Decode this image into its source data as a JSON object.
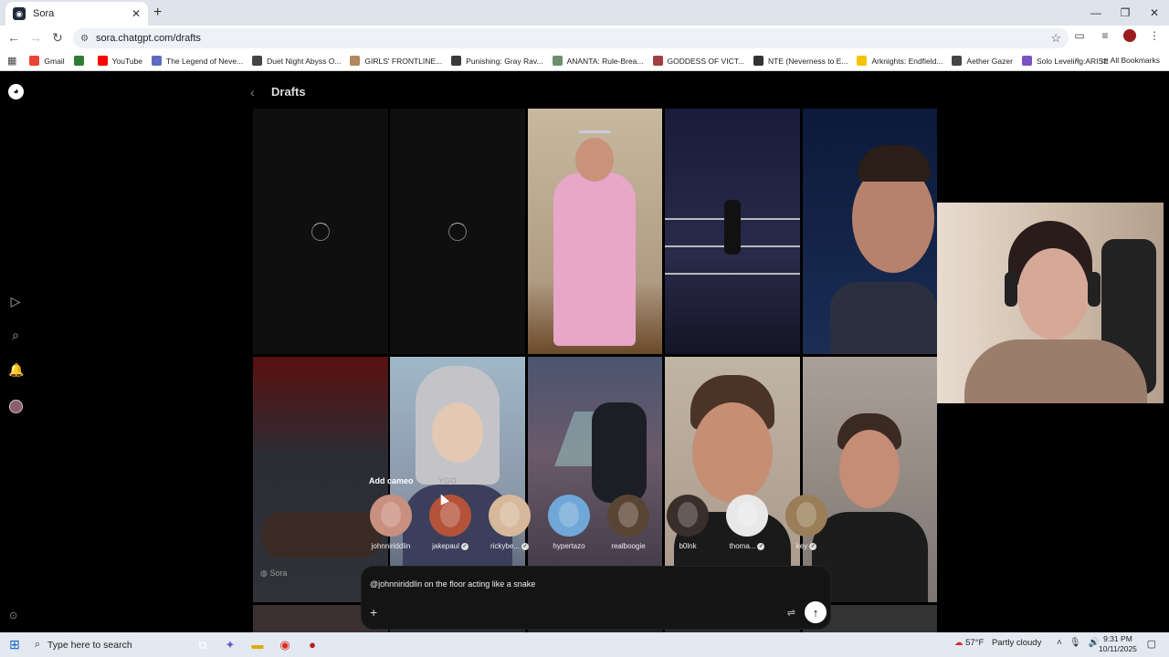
{
  "browser": {
    "tab_title": "Sora",
    "tab_favicon": "sora-favicon",
    "url": "sora.chatgpt.com/drafts",
    "bookmarks": [
      {
        "label": "Gmail",
        "color": "#ea4335"
      },
      {
        "label": "",
        "color": "#2e7d32"
      },
      {
        "label": "YouTube",
        "color": "#ff0000"
      },
      {
        "label": "The Legend of Neve...",
        "color": "#5c6bc0"
      },
      {
        "label": "Duet Night Abyss O...",
        "color": "#444444"
      },
      {
        "label": "GIRLS' FRONTLINE...",
        "color": "#b0875a"
      },
      {
        "label": "Punishing: Gray Rav...",
        "color": "#3a3a3a"
      },
      {
        "label": "ANANTA: Rule-Brea...",
        "color": "#6d8f6d"
      },
      {
        "label": "GODDESS OF VICT...",
        "color": "#a04040"
      },
      {
        "label": "NTE (Neverness to E...",
        "color": "#333333"
      },
      {
        "label": "Arknights: Endfield...",
        "color": "#f5c400"
      },
      {
        "label": "Aether Gazer",
        "color": "#444444"
      },
      {
        "label": "Solo Leveling:ARISE",
        "color": "#7b52c4"
      }
    ],
    "all_bookmarks": "All Bookmarks"
  },
  "page": {
    "title": "Drafts"
  },
  "cameo": {
    "heading": "Add cameo",
    "heading2": "YGO",
    "people": [
      {
        "name": "johnniriddlin",
        "verified": false,
        "color": "#c98f7f"
      },
      {
        "name": "jakepaul",
        "verified": true,
        "color": "#b5533a"
      },
      {
        "name": "rickybe...",
        "verified": true,
        "color": "#d7b89a"
      },
      {
        "name": "hypertazo",
        "verified": false,
        "color": "#6fa7d8"
      },
      {
        "name": "realboogie",
        "verified": false,
        "color": "#5a4434"
      },
      {
        "name": "b0lnk",
        "verified": false,
        "color": "#3a2e2a"
      },
      {
        "name": "thoma...",
        "verified": true,
        "color": "#e8e8e8"
      },
      {
        "name": "key",
        "verified": true,
        "color": "#9a7e58"
      }
    ]
  },
  "prompt": {
    "text": "@johnniriddlin on the floor acting like a snake"
  },
  "watermark": "Sora",
  "taskbar": {
    "search_placeholder": "Type here to search",
    "temperature": "57°F",
    "weather": "Partly cloudy",
    "time": "9:31 PM",
    "date": "10/11/2025"
  }
}
